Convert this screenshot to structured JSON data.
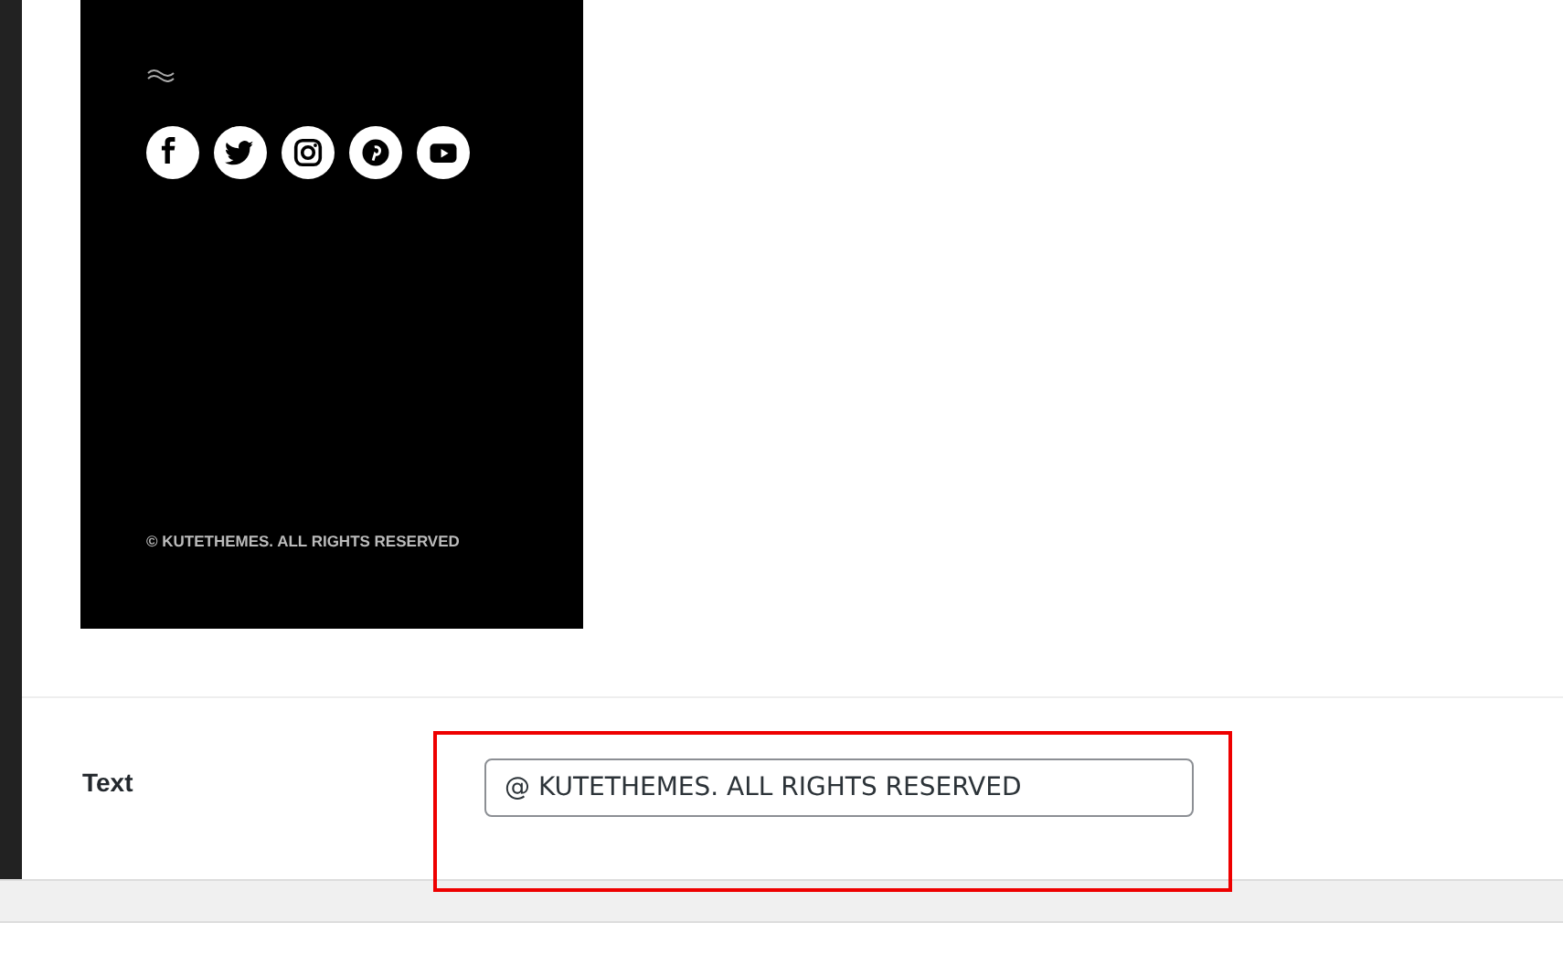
{
  "preview": {
    "social_links": [
      {
        "kind": "facebook"
      },
      {
        "kind": "twitter"
      },
      {
        "kind": "instagram"
      },
      {
        "kind": "pinterest"
      },
      {
        "kind": "youtube"
      }
    ],
    "copyright": "© KUTETHEMES. ALL RIGHTS RESERVED"
  },
  "setting": {
    "label": "Text",
    "value": "@ KUTETHEMES. ALL RIGHTS RESERVED",
    "highlighted": true
  }
}
